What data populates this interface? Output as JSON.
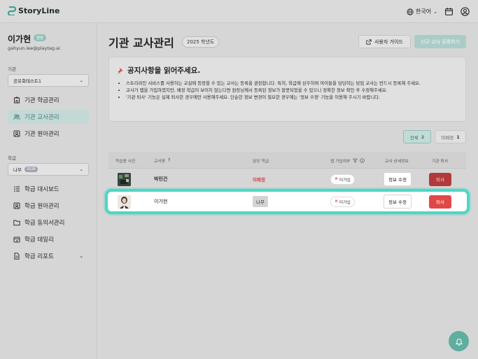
{
  "app": {
    "logo_text": "StoryLine",
    "language": "한국어",
    "brand_color": "#3fa08f"
  },
  "user": {
    "name": "이가현",
    "role": "원장",
    "email": "gahyun.lee@playtag.ai"
  },
  "sidebar": {
    "institution_label": "기관",
    "institution_value": "공유회테스트1",
    "institution_items": [
      {
        "label": "기관 학급관리",
        "icon": "building-icon"
      },
      {
        "label": "기관 교사관리",
        "icon": "users-icon"
      },
      {
        "label": "기관 원아관리",
        "icon": "child-icon"
      }
    ],
    "class_label": "학급",
    "class_value": "나무",
    "class_year": "2026",
    "class_items": [
      {
        "label": "학급 대시보드",
        "icon": "dashboard-icon"
      },
      {
        "label": "학급 원아관리",
        "icon": "child-icon"
      },
      {
        "label": "학급 동의서관리",
        "icon": "folder-icon"
      },
      {
        "label": "학급 데일리",
        "icon": "calendar-icon"
      },
      {
        "label": "학급 리포트",
        "icon": "document-icon"
      }
    ]
  },
  "main": {
    "title": "기관 교사관리",
    "year_chip": "2025 학년도",
    "guide_button": "사용자 가이드",
    "register_button": "신규 교사 등록하기",
    "notice": {
      "title": "공지사항을 읽어주세요.",
      "items": [
        "스토리라인 서비스를 사용하는 교실에 등장할 수 있는 교사는 등록을 권장합니다. 특히, 학급에 상주하며 아이들을 담당하는 담임 교사는 반드시 등록해 주세요.",
        "교사가 앱을 가입하였지만, 배정 학급이 보이지 않는다면 원장님께서 등록된 정보가 잘못되었을 수 있으니 정확한 정보 확인 후 수정해주세요.",
        "'기관 퇴사' 기능은 실제 퇴사한 경우에만 사용해주세요. 단순한 정보 변경이 필요한 경우에는 '정보 수정' 기능을 이용해 주시기 바랍니다."
      ]
    },
    "filters": {
      "all_label": "전체",
      "all_count": "2",
      "unassigned_label": "미배정",
      "unassigned_count": "1"
    },
    "table": {
      "headers": {
        "photo": "학습용 사진",
        "teacher": "교사명",
        "class": "담당 학급",
        "app": "앱 가입여부",
        "info": "교사 상세정보",
        "resign": "기관 퇴사"
      },
      "rows": [
        {
          "name": "박민건",
          "class": "미배정",
          "app_status": "미가입",
          "edit": "정보 수정",
          "resign": "퇴사"
        },
        {
          "name": "이가현",
          "class": "나무",
          "app_status": "미가입",
          "edit": "정보 수정",
          "resign": "퇴사"
        }
      ]
    }
  }
}
